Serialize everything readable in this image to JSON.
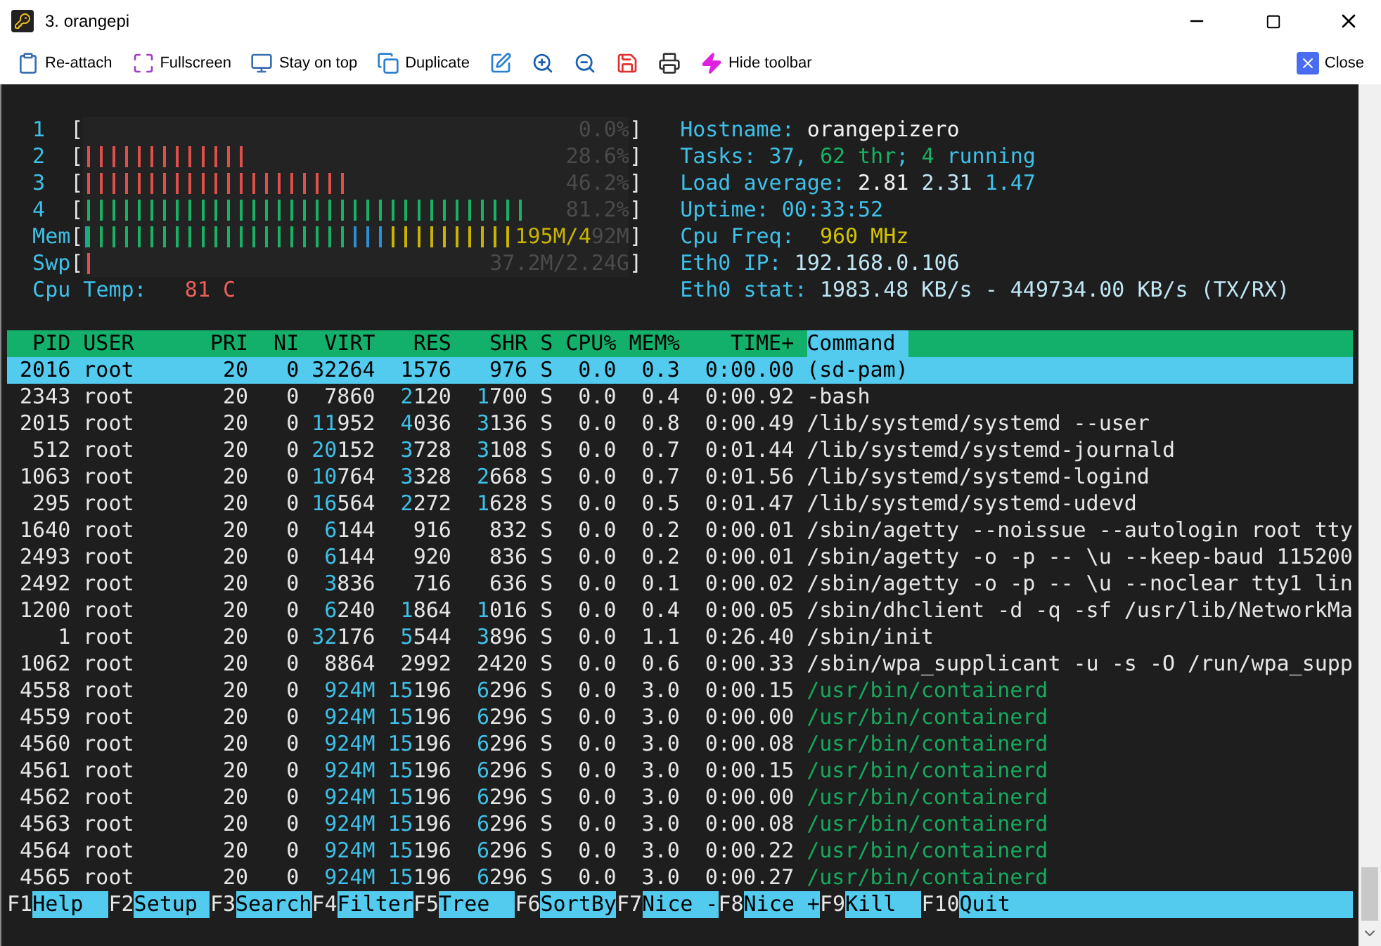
{
  "window": {
    "title": "3. orangepi"
  },
  "toolbar": {
    "items": [
      {
        "label": "Re-attach"
      },
      {
        "label": "Fullscreen"
      },
      {
        "label": "Stay on top"
      },
      {
        "label": "Duplicate"
      }
    ],
    "hide": {
      "label": "Hide toolbar"
    },
    "close": {
      "label": "Close"
    }
  },
  "meters": {
    "bracket_open": "[",
    "bracket_close": "]",
    "items": [
      {
        "label": "1",
        "reading": "0.0%"
      },
      {
        "label": "2",
        "reading": "28.6%",
        "segments": [
          {
            "color": "#e0504a",
            "level": 0.3
          }
        ]
      },
      {
        "label": "3",
        "reading": "46.2%",
        "segments": [
          {
            "color": "#e0504a",
            "level": 0.48
          }
        ]
      },
      {
        "label": "4",
        "reading": "81.2%",
        "segments": [
          {
            "color": "#17b266",
            "level": 0.81
          }
        ]
      },
      {
        "label": "Mem",
        "reading": "195M/4",
        "reading_rest": "92M",
        "segments": [
          {
            "color": "#17b266",
            "level": 0.49
          },
          {
            "color": "#2b8fd6",
            "level": 0.56
          },
          {
            "color": "#c8b400",
            "level": 0.78
          }
        ]
      },
      {
        "label": "Swp",
        "reading": "37.2M/2.24G",
        "segments": [
          {
            "color": "#e0504a",
            "level": 0.02
          }
        ]
      }
    ]
  },
  "cpu_temp": {
    "parts": [
      {
        "text": "Cpu Temp:   ",
        "color": "#3fc0e8"
      },
      {
        "text": "81 C",
        "color": "#f0605a"
      }
    ]
  },
  "info": [
    {
      "parts": [
        {
          "text": "Hostname: ",
          "color": "#3fc0e8"
        },
        {
          "text": "orangepizero",
          "color": "#f2f2f2"
        }
      ]
    },
    {
      "parts": [
        {
          "text": "Tasks: 37, ",
          "color": "#3fc0e8"
        },
        {
          "text": "62 thr",
          "color": "#17b266"
        },
        {
          "text": "; ",
          "color": "#3fc0e8"
        },
        {
          "text": "4",
          "color": "#17b266"
        },
        {
          "text": " running",
          "color": "#3fc0e8"
        }
      ]
    },
    {
      "parts": [
        {
          "text": "Load average: ",
          "color": "#3fc0e8"
        },
        {
          "text": "2.81 ",
          "color": "#f2f2f2"
        },
        {
          "text": "2.31 ",
          "color": "#bfe6f3"
        },
        {
          "text": "1.47",
          "color": "#3fc0e8"
        }
      ]
    },
    {
      "parts": [
        {
          "text": "Uptime: ",
          "color": "#3fc0e8"
        },
        {
          "text": "00:33:52",
          "color": "#3fc0e8"
        }
      ]
    },
    {
      "parts": [
        {
          "text": "Cpu Freq:  ",
          "color": "#3fc0e8"
        },
        {
          "text": "960 MHz",
          "color": "#d4c400"
        }
      ]
    },
    {
      "parts": [
        {
          "text": "Eth0 IP: ",
          "color": "#3fc0e8"
        },
        {
          "text": "192.168.0.106",
          "color": "#bfe6f3"
        }
      ]
    },
    {
      "parts": [
        {
          "text": "Eth0 stat: ",
          "color": "#3fc0e8"
        },
        {
          "text": "1983.48 KB/s - 449734.00 KB/s (TX/RX)",
          "color": "#bfe6f3"
        }
      ]
    }
  ],
  "table": {
    "columns": [
      {
        "label": "PID",
        "selected": false
      },
      {
        "label": "USER",
        "selected": false
      },
      {
        "label": "PRI",
        "selected": false
      },
      {
        "label": "NI",
        "selected": false
      },
      {
        "label": "VIRT",
        "selected": false
      },
      {
        "label": "RES",
        "selected": false
      },
      {
        "label": "SHR",
        "selected": false
      },
      {
        "label": "S",
        "selected": false
      },
      {
        "label": "CPU%",
        "selected": false
      },
      {
        "label": "MEM%",
        "selected": false
      },
      {
        "label": "TIME+",
        "selected": false
      },
      {
        "label": "Command",
        "selected": true
      }
    ],
    "rows": [
      {
        "selected": true,
        "kind": "process",
        "pid": "2016",
        "user": "root",
        "pri": "20",
        "ni": "0",
        "virt": {
          "hi": "32",
          "lo": "264"
        },
        "res": {
          "hi": "1",
          "lo": "576"
        },
        "shr": {
          "lo": "976"
        },
        "s": "S",
        "cpu": "0.0",
        "mem": "0.3",
        "time": "0:00.00",
        "command": "(sd-pam)"
      },
      {
        "selected": false,
        "kind": "process",
        "pid": "2343",
        "user": "root",
        "pri": "20",
        "ni": "0",
        "virt": {
          "lo": "7860"
        },
        "res": {
          "hi": "2",
          "lo": "120"
        },
        "shr": {
          "hi": "1",
          "lo": "700"
        },
        "s": "S",
        "cpu": "0.0",
        "mem": "0.4",
        "time": "0:00.92",
        "command": "-bash"
      },
      {
        "selected": false,
        "kind": "process",
        "pid": "2015",
        "user": "root",
        "pri": "20",
        "ni": "0",
        "virt": {
          "hi": "11",
          "lo": "952"
        },
        "res": {
          "hi": "4",
          "lo": "036"
        },
        "shr": {
          "hi": "3",
          "lo": "136"
        },
        "s": "S",
        "cpu": "0.0",
        "mem": "0.8",
        "time": "0:00.49",
        "command": "/lib/systemd/systemd --user"
      },
      {
        "selected": false,
        "kind": "process",
        "pid": "512",
        "user": "root",
        "pri": "20",
        "ni": "0",
        "virt": {
          "hi": "20",
          "lo": "152"
        },
        "res": {
          "hi": "3",
          "lo": "728"
        },
        "shr": {
          "hi": "3",
          "lo": "108"
        },
        "s": "S",
        "cpu": "0.0",
        "mem": "0.7",
        "time": "0:01.44",
        "command": "/lib/systemd/systemd-journald"
      },
      {
        "selected": false,
        "kind": "process",
        "pid": "1063",
        "user": "root",
        "pri": "20",
        "ni": "0",
        "virt": {
          "hi": "10",
          "lo": "764"
        },
        "res": {
          "hi": "3",
          "lo": "328"
        },
        "shr": {
          "hi": "2",
          "lo": "668"
        },
        "s": "S",
        "cpu": "0.0",
        "mem": "0.7",
        "time": "0:01.56",
        "command": "/lib/systemd/systemd-logind"
      },
      {
        "selected": false,
        "kind": "process",
        "pid": "295",
        "user": "root",
        "pri": "20",
        "ni": "0",
        "virt": {
          "hi": "16",
          "lo": "564"
        },
        "res": {
          "hi": "2",
          "lo": "272"
        },
        "shr": {
          "hi": "1",
          "lo": "628"
        },
        "s": "S",
        "cpu": "0.0",
        "mem": "0.5",
        "time": "0:01.47",
        "command": "/lib/systemd/systemd-udevd"
      },
      {
        "selected": false,
        "kind": "process",
        "pid": "1640",
        "user": "root",
        "pri": "20",
        "ni": "0",
        "virt": {
          "hi": "6",
          "lo": "144"
        },
        "res": {
          "lo": "916"
        },
        "shr": {
          "lo": "832"
        },
        "s": "S",
        "cpu": "0.0",
        "mem": "0.2",
        "time": "0:00.01",
        "command": "/sbin/agetty --noissue --autologin root tty"
      },
      {
        "selected": false,
        "kind": "process",
        "pid": "2493",
        "user": "root",
        "pri": "20",
        "ni": "0",
        "virt": {
          "hi": "6",
          "lo": "144"
        },
        "res": {
          "lo": "920"
        },
        "shr": {
          "lo": "836"
        },
        "s": "S",
        "cpu": "0.0",
        "mem": "0.2",
        "time": "0:00.01",
        "command": "/sbin/agetty -o -p -- \\u --keep-baud 115200"
      },
      {
        "selected": false,
        "kind": "process",
        "pid": "2492",
        "user": "root",
        "pri": "20",
        "ni": "0",
        "virt": {
          "hi": "3",
          "lo": "836"
        },
        "res": {
          "lo": "716"
        },
        "shr": {
          "lo": "636"
        },
        "s": "S",
        "cpu": "0.0",
        "mem": "0.1",
        "time": "0:00.02",
        "command": "/sbin/agetty -o -p -- \\u --noclear tty1 lin"
      },
      {
        "selected": false,
        "kind": "process",
        "pid": "1200",
        "user": "root",
        "pri": "20",
        "ni": "0",
        "virt": {
          "hi": "6",
          "lo": "240"
        },
        "res": {
          "hi": "1",
          "lo": "864"
        },
        "shr": {
          "hi": "1",
          "lo": "016"
        },
        "s": "S",
        "cpu": "0.0",
        "mem": "0.4",
        "time": "0:00.05",
        "command": "/sbin/dhclient -d -q -sf /usr/lib/NetworkMa"
      },
      {
        "selected": false,
        "kind": "process",
        "pid": "1",
        "user": "root",
        "pri": "20",
        "ni": "0",
        "virt": {
          "hi": "32",
          "lo": "176"
        },
        "res": {
          "hi": "5",
          "lo": "544"
        },
        "shr": {
          "hi": "3",
          "lo": "896"
        },
        "s": "S",
        "cpu": "0.0",
        "mem": "1.1",
        "time": "0:26.40",
        "command": "/sbin/init"
      },
      {
        "selected": false,
        "kind": "process",
        "pid": "1062",
        "user": "root",
        "pri": "20",
        "ni": "0",
        "virt": {
          "lo": "8864"
        },
        "res": {
          "lo": "2992"
        },
        "shr": {
          "lo": "2420"
        },
        "s": "S",
        "cpu": "0.0",
        "mem": "0.6",
        "time": "0:00.33",
        "command": "/sbin/wpa_supplicant -u -s -O /run/wpa_supp"
      },
      {
        "selected": false,
        "kind": "thread",
        "pid": "4558",
        "user": "root",
        "pri": "20",
        "ni": "0",
        "virt": {
          "hi": "924M"
        },
        "res": {
          "hi": "15",
          "lo": "196"
        },
        "shr": {
          "hi": "6",
          "lo": "296"
        },
        "s": "S",
        "cpu": "0.0",
        "mem": "3.0",
        "time": "0:00.15",
        "command": "/usr/bin/containerd"
      },
      {
        "selected": false,
        "kind": "thread",
        "pid": "4559",
        "user": "root",
        "pri": "20",
        "ni": "0",
        "virt": {
          "hi": "924M"
        },
        "res": {
          "hi": "15",
          "lo": "196"
        },
        "shr": {
          "hi": "6",
          "lo": "296"
        },
        "s": "S",
        "cpu": "0.0",
        "mem": "3.0",
        "time": "0:00.00",
        "command": "/usr/bin/containerd"
      },
      {
        "selected": false,
        "kind": "thread",
        "pid": "4560",
        "user": "root",
        "pri": "20",
        "ni": "0",
        "virt": {
          "hi": "924M"
        },
        "res": {
          "hi": "15",
          "lo": "196"
        },
        "shr": {
          "hi": "6",
          "lo": "296"
        },
        "s": "S",
        "cpu": "0.0",
        "mem": "3.0",
        "time": "0:00.08",
        "command": "/usr/bin/containerd"
      },
      {
        "selected": false,
        "kind": "thread",
        "pid": "4561",
        "user": "root",
        "pri": "20",
        "ni": "0",
        "virt": {
          "hi": "924M"
        },
        "res": {
          "hi": "15",
          "lo": "196"
        },
        "shr": {
          "hi": "6",
          "lo": "296"
        },
        "s": "S",
        "cpu": "0.0",
        "mem": "3.0",
        "time": "0:00.15",
        "command": "/usr/bin/containerd"
      },
      {
        "selected": false,
        "kind": "thread",
        "pid": "4562",
        "user": "root",
        "pri": "20",
        "ni": "0",
        "virt": {
          "hi": "924M"
        },
        "res": {
          "hi": "15",
          "lo": "196"
        },
        "shr": {
          "hi": "6",
          "lo": "296"
        },
        "s": "S",
        "cpu": "0.0",
        "mem": "3.0",
        "time": "0:00.00",
        "command": "/usr/bin/containerd"
      },
      {
        "selected": false,
        "kind": "thread",
        "pid": "4563",
        "user": "root",
        "pri": "20",
        "ni": "0",
        "virt": {
          "hi": "924M"
        },
        "res": {
          "hi": "15",
          "lo": "196"
        },
        "shr": {
          "hi": "6",
          "lo": "296"
        },
        "s": "S",
        "cpu": "0.0",
        "mem": "3.0",
        "time": "0:00.08",
        "command": "/usr/bin/containerd"
      },
      {
        "selected": false,
        "kind": "thread",
        "pid": "4564",
        "user": "root",
        "pri": "20",
        "ni": "0",
        "virt": {
          "hi": "924M"
        },
        "res": {
          "hi": "15",
          "lo": "196"
        },
        "shr": {
          "hi": "6",
          "lo": "296"
        },
        "s": "S",
        "cpu": "0.0",
        "mem": "3.0",
        "time": "0:00.22",
        "command": "/usr/bin/containerd"
      },
      {
        "selected": false,
        "kind": "thread",
        "pid": "4565",
        "user": "root",
        "pri": "20",
        "ni": "0",
        "virt": {
          "hi": "924M"
        },
        "res": {
          "hi": "15",
          "lo": "196"
        },
        "shr": {
          "hi": "6",
          "lo": "296"
        },
        "s": "S",
        "cpu": "0.0",
        "mem": "3.0",
        "time": "0:00.27",
        "command": "/usr/bin/containerd"
      }
    ]
  },
  "function_keys": [
    {
      "key": "F1",
      "label": "Help"
    },
    {
      "key": "F2",
      "label": "Setup"
    },
    {
      "key": "F3",
      "label": "Search"
    },
    {
      "key": "F4",
      "label": "Filter"
    },
    {
      "key": "F5",
      "label": "Tree"
    },
    {
      "key": "F6",
      "label": "SortBy"
    },
    {
      "key": "F7",
      "label": "Nice -"
    },
    {
      "key": "F8",
      "label": "Nice +"
    },
    {
      "key": "F9",
      "label": "Kill"
    },
    {
      "key": "F10",
      "label": "Quit"
    }
  ]
}
